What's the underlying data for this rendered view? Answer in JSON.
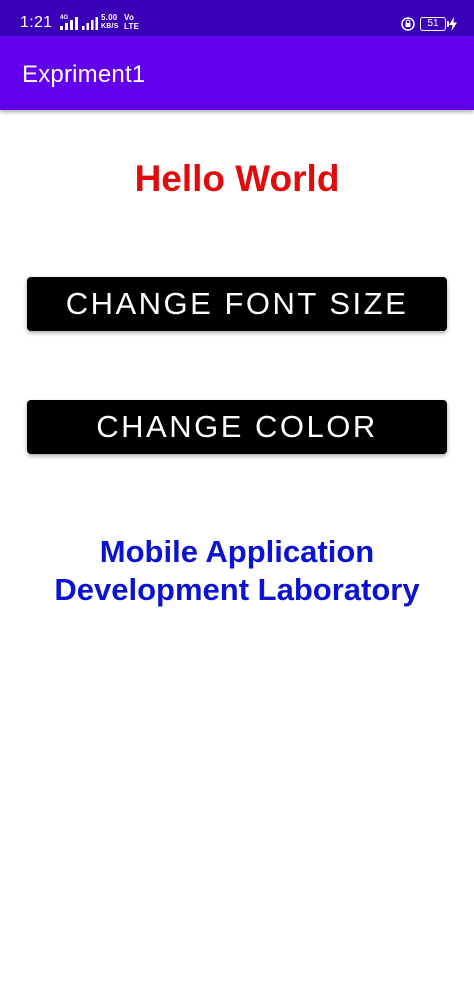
{
  "status_bar": {
    "time": "1:21",
    "network_label": "4G",
    "speed_value": "5.00",
    "speed_unit": "KB/S",
    "volte_top": "Vo",
    "volte_bottom": "LTE",
    "battery_level": "51",
    "bg_color": "#3a00b8"
  },
  "app_bar": {
    "title": "Expriment1",
    "bg_color": "#6200ee"
  },
  "main": {
    "hello_text": "Hello World",
    "hello_color": "#e00b0b",
    "change_font_size_label": "CHANGE FONT SIZE",
    "change_color_label": "CHANGE COLOR",
    "lab_line1": "Mobile Application",
    "lab_line2": "Development Laboratory",
    "lab_color": "#0b12d0"
  }
}
